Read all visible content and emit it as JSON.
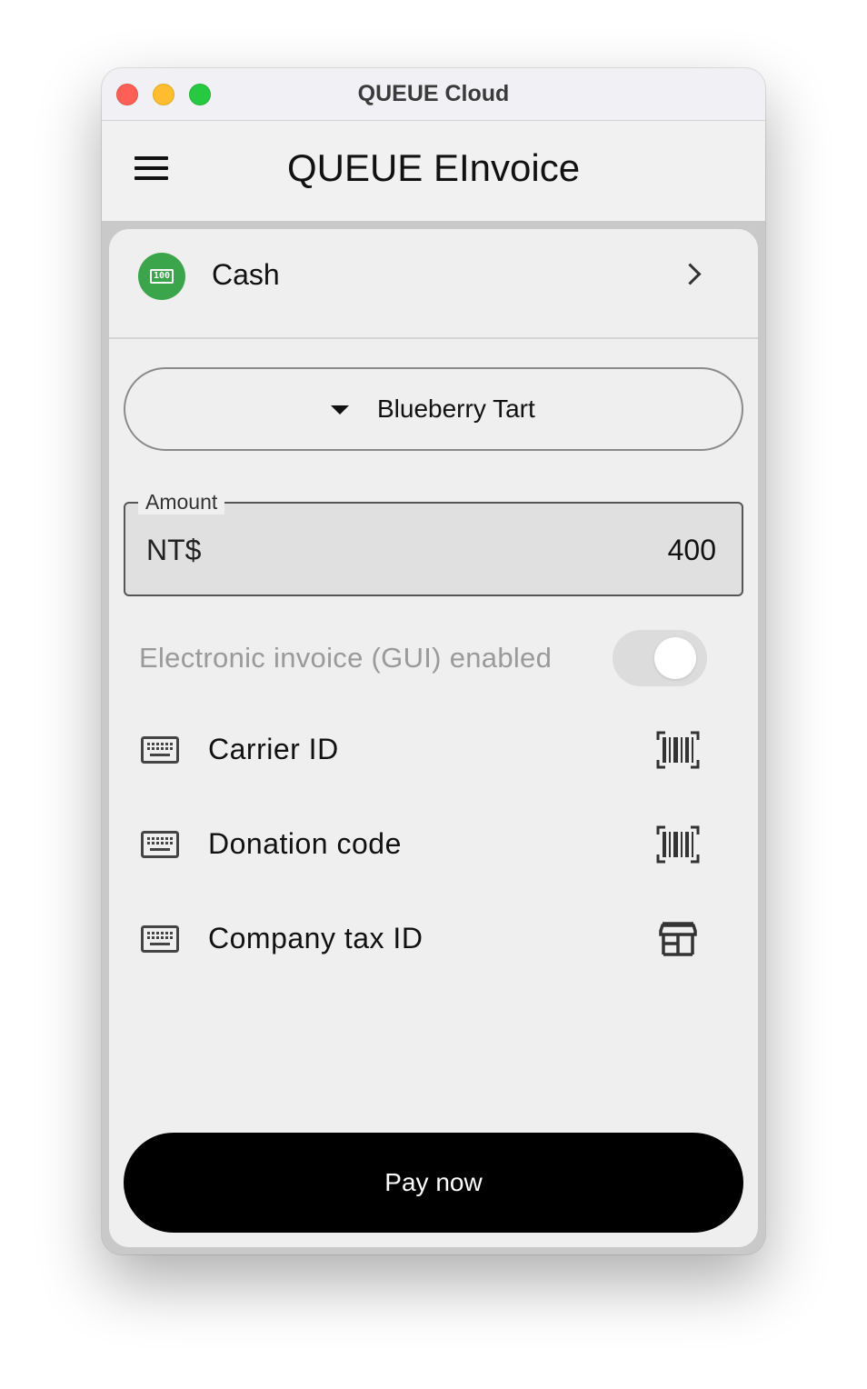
{
  "window": {
    "title": "QUEUE Cloud"
  },
  "appbar": {
    "title": "QUEUE EInvoice",
    "menu_icon": "menu-icon"
  },
  "payment_method": {
    "label": "Cash",
    "icon": "cash-icon",
    "badge_text": "100",
    "icon_color": "#3aa54a"
  },
  "product": {
    "selected": "Blueberry Tart"
  },
  "amount": {
    "label": "Amount",
    "prefix": "NT$",
    "value": "400"
  },
  "einvoice": {
    "label": "Electronic invoice (GUI) enabled",
    "enabled": false
  },
  "fields": [
    {
      "label": "Carrier ID",
      "icon": "keyboard-icon",
      "action_icon": "barcode-scan-icon"
    },
    {
      "label": "Donation code",
      "icon": "keyboard-icon",
      "action_icon": "barcode-scan-icon"
    },
    {
      "label": "Company tax ID",
      "icon": "keyboard-icon",
      "action_icon": "storefront-icon"
    }
  ],
  "pay_button": {
    "label": "Pay now"
  }
}
